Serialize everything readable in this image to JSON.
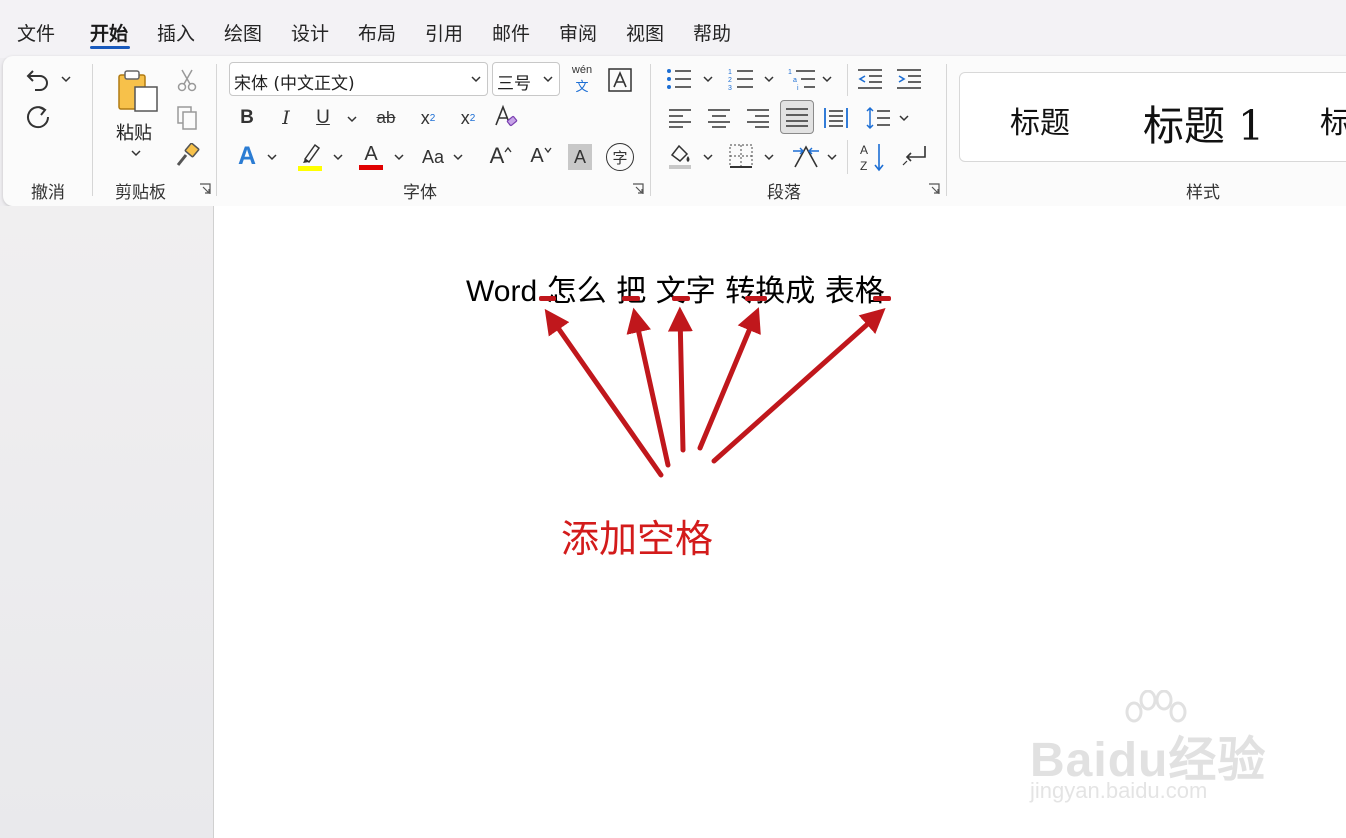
{
  "menu": {
    "file": "文件",
    "home": "开始",
    "insert": "插入",
    "draw": "绘图",
    "design": "设计",
    "layout": "布局",
    "references": "引用",
    "mailings": "邮件",
    "review": "审阅",
    "view": "视图",
    "help": "帮助"
  },
  "ribbon": {
    "undo_group": "撤消",
    "clipboard_group": "剪贴板",
    "paste_label": "粘贴",
    "font_group": "字体",
    "paragraph_group": "段落",
    "styles_group": "样式",
    "font_name": "宋体 (中文正文)",
    "font_size": "三号",
    "phonetic_top": "wén",
    "phonetic_bottom": "文",
    "bold": "B",
    "italic": "I",
    "underline": "U",
    "strikethrough": "ab",
    "subscript": "x",
    "subscript_mark": "2",
    "superscript": "x",
    "superscript_mark": "2",
    "text_effects": "A",
    "font_color": "A",
    "change_case": "Aa",
    "grow_font": "A",
    "shrink_font": "A",
    "char_shading": "A",
    "enclose_char": "字",
    "styles": {
      "title": "标题",
      "heading1": "标题 1",
      "next": "标"
    }
  },
  "document": {
    "line_word": "Word",
    "line_rest": " 怎么 把 文字 转换成 表格",
    "annotation": "添加空格"
  },
  "watermark": {
    "main": "Baidu经验",
    "sub": "jingyan.baidu.com"
  },
  "colors": {
    "accent": "#185abd",
    "annotation_red": "#d31b1b",
    "arrow_red": "#c0171c",
    "highlight_yellow": "#ffff00",
    "font_color_red": "#e00000"
  }
}
